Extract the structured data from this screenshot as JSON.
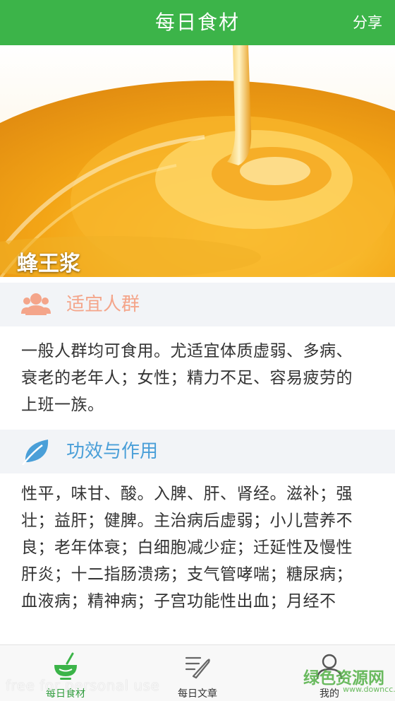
{
  "header": {
    "title": "每日食材",
    "share_label": "分享"
  },
  "hero": {
    "food_name": "蜂王浆",
    "image": "honey-pour-image"
  },
  "sections": [
    {
      "title": "适宜人群",
      "icon": "people-icon",
      "color": "#f4a58a",
      "text": "一般人群均可食用。尤适宜体质虚弱、多病、衰老的老年人；女性；精力不足、容易疲劳的上班一族。"
    },
    {
      "title": "功效与作用",
      "icon": "leaf-icon",
      "color": "#4a9fd8",
      "text": "性平，味甘、酸。入脾、肝、肾经。滋补；强壮；益肝；健脾。主治病后虚弱；小儿营养不良；老年体衰；白细胞减少症；迁延性及慢性肝炎；十二指肠溃疡；支气管哮喘；糖尿病；血液病；精神病；子宫功能性出血；月经不"
    }
  ],
  "tabs": [
    {
      "label": "每日食材",
      "icon": "bowl-icon",
      "active": true
    },
    {
      "label": "每日文章",
      "icon": "article-icon",
      "active": false
    },
    {
      "label": "我的",
      "icon": "user-icon",
      "active": false
    }
  ],
  "watermarks": {
    "left": "free for personal use",
    "right_title": "绿色资源网",
    "right_url": "www.downcc.com"
  },
  "colors": {
    "header_green": "#3cb449",
    "section_bg": "#f2f4f7"
  }
}
